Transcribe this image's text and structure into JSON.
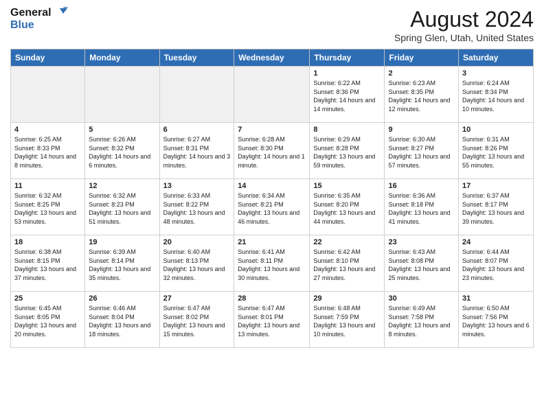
{
  "logo": {
    "line1": "General",
    "line2": "Blue"
  },
  "title": "August 2024",
  "location": "Spring Glen, Utah, United States",
  "days_of_week": [
    "Sunday",
    "Monday",
    "Tuesday",
    "Wednesday",
    "Thursday",
    "Friday",
    "Saturday"
  ],
  "weeks": [
    [
      {
        "day": "",
        "info": ""
      },
      {
        "day": "",
        "info": ""
      },
      {
        "day": "",
        "info": ""
      },
      {
        "day": "",
        "info": ""
      },
      {
        "day": "1",
        "info": "Sunrise: 6:22 AM\nSunset: 8:36 PM\nDaylight: 14 hours and 14 minutes."
      },
      {
        "day": "2",
        "info": "Sunrise: 6:23 AM\nSunset: 8:35 PM\nDaylight: 14 hours and 12 minutes."
      },
      {
        "day": "3",
        "info": "Sunrise: 6:24 AM\nSunset: 8:34 PM\nDaylight: 14 hours and 10 minutes."
      }
    ],
    [
      {
        "day": "4",
        "info": "Sunrise: 6:25 AM\nSunset: 8:33 PM\nDaylight: 14 hours and 8 minutes."
      },
      {
        "day": "5",
        "info": "Sunrise: 6:26 AM\nSunset: 8:32 PM\nDaylight: 14 hours and 6 minutes."
      },
      {
        "day": "6",
        "info": "Sunrise: 6:27 AM\nSunset: 8:31 PM\nDaylight: 14 hours and 3 minutes."
      },
      {
        "day": "7",
        "info": "Sunrise: 6:28 AM\nSunset: 8:30 PM\nDaylight: 14 hours and 1 minute."
      },
      {
        "day": "8",
        "info": "Sunrise: 6:29 AM\nSunset: 8:28 PM\nDaylight: 13 hours and 59 minutes."
      },
      {
        "day": "9",
        "info": "Sunrise: 6:30 AM\nSunset: 8:27 PM\nDaylight: 13 hours and 57 minutes."
      },
      {
        "day": "10",
        "info": "Sunrise: 6:31 AM\nSunset: 8:26 PM\nDaylight: 13 hours and 55 minutes."
      }
    ],
    [
      {
        "day": "11",
        "info": "Sunrise: 6:32 AM\nSunset: 8:25 PM\nDaylight: 13 hours and 53 minutes."
      },
      {
        "day": "12",
        "info": "Sunrise: 6:32 AM\nSunset: 8:23 PM\nDaylight: 13 hours and 51 minutes."
      },
      {
        "day": "13",
        "info": "Sunrise: 6:33 AM\nSunset: 8:22 PM\nDaylight: 13 hours and 48 minutes."
      },
      {
        "day": "14",
        "info": "Sunrise: 6:34 AM\nSunset: 8:21 PM\nDaylight: 13 hours and 46 minutes."
      },
      {
        "day": "15",
        "info": "Sunrise: 6:35 AM\nSunset: 8:20 PM\nDaylight: 13 hours and 44 minutes."
      },
      {
        "day": "16",
        "info": "Sunrise: 6:36 AM\nSunset: 8:18 PM\nDaylight: 13 hours and 41 minutes."
      },
      {
        "day": "17",
        "info": "Sunrise: 6:37 AM\nSunset: 8:17 PM\nDaylight: 13 hours and 39 minutes."
      }
    ],
    [
      {
        "day": "18",
        "info": "Sunrise: 6:38 AM\nSunset: 8:15 PM\nDaylight: 13 hours and 37 minutes."
      },
      {
        "day": "19",
        "info": "Sunrise: 6:39 AM\nSunset: 8:14 PM\nDaylight: 13 hours and 35 minutes."
      },
      {
        "day": "20",
        "info": "Sunrise: 6:40 AM\nSunset: 8:13 PM\nDaylight: 13 hours and 32 minutes."
      },
      {
        "day": "21",
        "info": "Sunrise: 6:41 AM\nSunset: 8:11 PM\nDaylight: 13 hours and 30 minutes."
      },
      {
        "day": "22",
        "info": "Sunrise: 6:42 AM\nSunset: 8:10 PM\nDaylight: 13 hours and 27 minutes."
      },
      {
        "day": "23",
        "info": "Sunrise: 6:43 AM\nSunset: 8:08 PM\nDaylight: 13 hours and 25 minutes."
      },
      {
        "day": "24",
        "info": "Sunrise: 6:44 AM\nSunset: 8:07 PM\nDaylight: 13 hours and 23 minutes."
      }
    ],
    [
      {
        "day": "25",
        "info": "Sunrise: 6:45 AM\nSunset: 8:05 PM\nDaylight: 13 hours and 20 minutes."
      },
      {
        "day": "26",
        "info": "Sunrise: 6:46 AM\nSunset: 8:04 PM\nDaylight: 13 hours and 18 minutes."
      },
      {
        "day": "27",
        "info": "Sunrise: 6:47 AM\nSunset: 8:02 PM\nDaylight: 13 hours and 15 minutes."
      },
      {
        "day": "28",
        "info": "Sunrise: 6:47 AM\nSunset: 8:01 PM\nDaylight: 13 hours and 13 minutes."
      },
      {
        "day": "29",
        "info": "Sunrise: 6:48 AM\nSunset: 7:59 PM\nDaylight: 13 hours and 10 minutes."
      },
      {
        "day": "30",
        "info": "Sunrise: 6:49 AM\nSunset: 7:58 PM\nDaylight: 13 hours and 8 minutes."
      },
      {
        "day": "31",
        "info": "Sunrise: 6:50 AM\nSunset: 7:56 PM\nDaylight: 13 hours and 6 minutes."
      }
    ]
  ]
}
